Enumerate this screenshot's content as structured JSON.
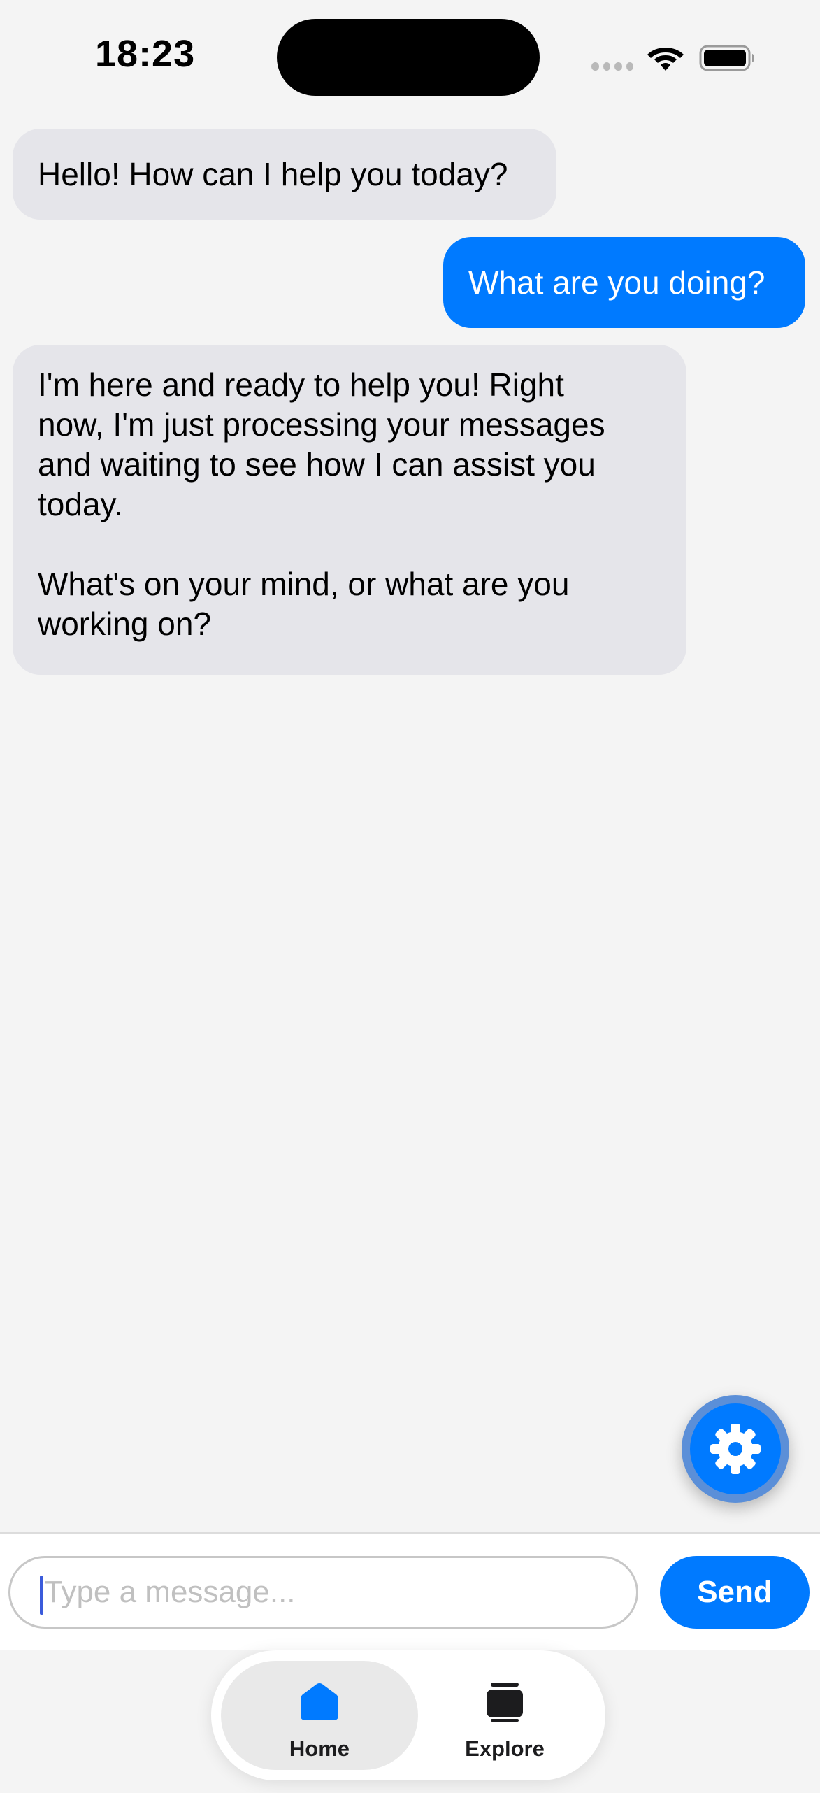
{
  "status_bar": {
    "time": "18:23",
    "icons": [
      "cellular-signal-icon",
      "wifi-icon",
      "battery-icon"
    ]
  },
  "messages": [
    {
      "role": "assistant",
      "text": "Hello! How can I help you today?"
    },
    {
      "role": "user",
      "text": "What are you doing?"
    },
    {
      "role": "assistant",
      "text": "I'm here and ready to help you! Right\nnow, I'm just processing your messages\nand waiting to see how I can assist you\ntoday.\n\nWhat's on your mind, or what are you\nworking on?"
    }
  ],
  "settings_button": {
    "icon": "gear-icon"
  },
  "composer": {
    "value": "",
    "placeholder": "Type a message...",
    "send_label": "Send"
  },
  "tab_bar": {
    "tabs": [
      {
        "label": "Home",
        "icon": "house-icon",
        "active": true
      },
      {
        "label": "Explore",
        "icon": "stack-icon",
        "active": false
      }
    ]
  },
  "colors": {
    "accent": "#007aff",
    "assistant_bubble": "#e5e5ea",
    "background": "#f4f4f4"
  }
}
